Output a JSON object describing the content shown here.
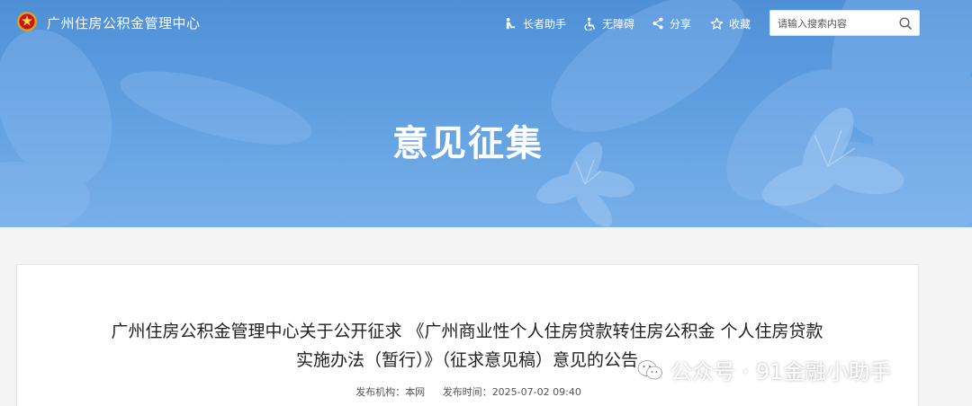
{
  "header": {
    "site_name": "广州住房公积金管理中心",
    "nav": [
      {
        "label": "长者助手",
        "icon": "elder-care-icon"
      },
      {
        "label": "无障碍",
        "icon": "accessibility-icon"
      },
      {
        "label": "分享",
        "icon": "share-icon"
      },
      {
        "label": "收藏",
        "icon": "star-icon"
      }
    ],
    "search": {
      "placeholder": "请输入搜索内容",
      "icon": "search-icon"
    }
  },
  "banner": {
    "title": "意见征集"
  },
  "article": {
    "title_line1": "广州住房公积金管理中心关于公开征求 《广州商业性个人住房贷款转住房公积金 个人住房贷款",
    "title_line2": "实施办法（暂行）》（征求意见稿）意见的公告",
    "source_label": "发布机构：",
    "source_value": "本网",
    "time_label": "发布时间：",
    "time_value": "2025-07-02 09:40"
  },
  "watermark": {
    "text": "公众号 · 91金融小助手"
  },
  "colors": {
    "banner": "#5b9be0",
    "text": "#222222",
    "card": "#ffffff"
  }
}
